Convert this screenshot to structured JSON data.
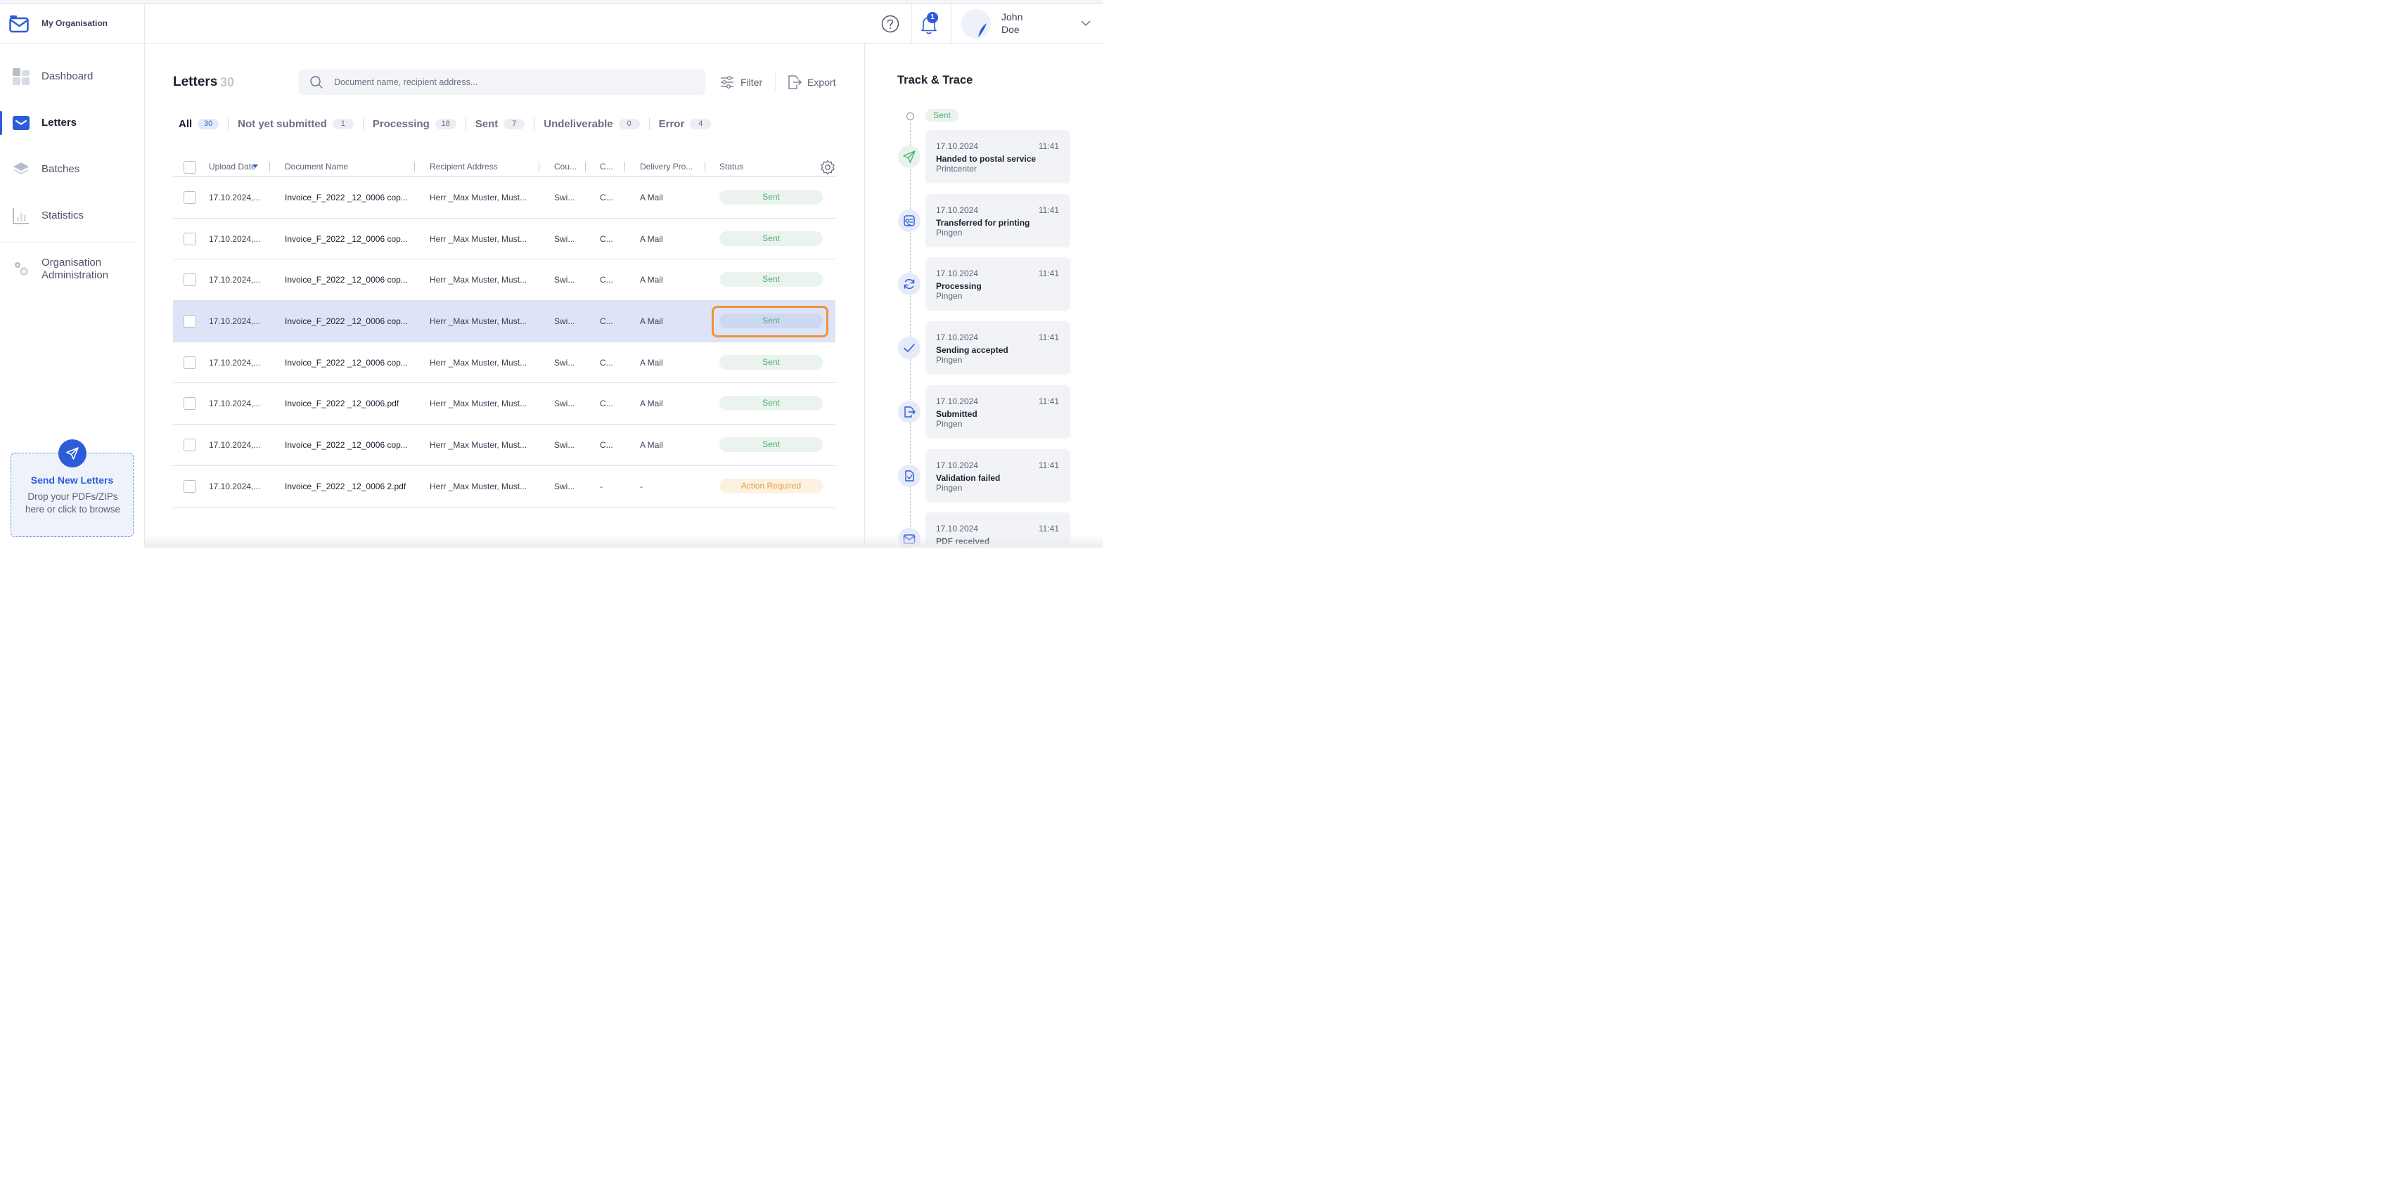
{
  "sidebar": {
    "org_name": "My Organisation",
    "nav": [
      {
        "label": "Dashboard",
        "icon": "dashboard-icon"
      },
      {
        "label": "Letters",
        "icon": "envelope-icon",
        "active": true
      },
      {
        "label": "Batches",
        "icon": "layers-icon"
      },
      {
        "label": "Statistics",
        "icon": "bar-chart-icon"
      },
      {
        "label": "Organisation Administration",
        "icon": "gear-icon"
      }
    ],
    "send": {
      "title": "Send New Letters",
      "description": "Drop your PDFs/ZIPs here or click to browse"
    }
  },
  "header": {
    "notification_count": "1",
    "user_first_name": "John",
    "user_last_name": "Doe"
  },
  "main": {
    "title": "Letters",
    "count": "30",
    "search_placeholder": "Document name, recipient address...",
    "filter_label": "Filter",
    "export_label": "Export",
    "tabs": [
      {
        "label": "All",
        "count": "30",
        "active": true
      },
      {
        "label": "Not yet submitted",
        "count": "1"
      },
      {
        "label": "Processing",
        "count": "18"
      },
      {
        "label": "Sent",
        "count": "7"
      },
      {
        "label": "Undeliverable",
        "count": "0"
      },
      {
        "label": "Error",
        "count": "4"
      }
    ],
    "columns": [
      "Upload Date",
      "Document Name",
      "Recipient Address",
      "Cou...",
      "C...",
      "Delivery Pro...",
      "Status"
    ],
    "rows": [
      {
        "date": "17.10.2024,...",
        "doc": "Invoice_F_2022 _12_0006 cop...",
        "recipient": "Herr _Max Muster, Must...",
        "country": "Swi...",
        "c": "C...",
        "delivery": "A Mail",
        "status": "Sent",
        "status_type": "sent"
      },
      {
        "date": "17.10.2024,...",
        "doc": "Invoice_F_2022 _12_0006 cop...",
        "recipient": "Herr _Max Muster, Must...",
        "country": "Swi...",
        "c": "C...",
        "delivery": "A Mail",
        "status": "Sent",
        "status_type": "sent"
      },
      {
        "date": "17.10.2024,...",
        "doc": "Invoice_F_2022 _12_0006 cop...",
        "recipient": "Herr _Max Muster, Must...",
        "country": "Swi...",
        "c": "C...",
        "delivery": "A Mail",
        "status": "Sent",
        "status_type": "sent"
      },
      {
        "date": "17.10.2024,...",
        "doc": "Invoice_F_2022 _12_0006 cop...",
        "recipient": "Herr _Max Muster, Must...",
        "country": "Swi...",
        "c": "C...",
        "delivery": "A Mail",
        "status": "Sent",
        "status_type": "sent",
        "selected": true
      },
      {
        "date": "17.10.2024,...",
        "doc": "Invoice_F_2022 _12_0006 cop...",
        "recipient": "Herr _Max Muster, Must...",
        "country": "Swi...",
        "c": "C...",
        "delivery": "A Mail",
        "status": "Sent",
        "status_type": "sent"
      },
      {
        "date": "17.10.2024,...",
        "doc": "Invoice_F_2022 _12_0006.pdf",
        "recipient": "Herr _Max Muster, Must...",
        "country": "Swi...",
        "c": "C...",
        "delivery": "A Mail",
        "status": "Sent",
        "status_type": "sent"
      },
      {
        "date": "17.10.2024,...",
        "doc": "Invoice_F_2022 _12_0006 cop...",
        "recipient": "Herr _Max Muster, Must...",
        "country": "Swi...",
        "c": "C...",
        "delivery": "A Mail",
        "status": "Sent",
        "status_type": "sent"
      },
      {
        "date": "17.10.2024,...",
        "doc": "Invoice_F_2022 _12_0006 2.pdf",
        "recipient": "Herr _Max Muster, Must...",
        "country": "Swi...",
        "c": "-",
        "delivery": "-",
        "status": "Action Required",
        "status_type": "warning"
      }
    ]
  },
  "trace": {
    "title": "Track & Trace",
    "current_status": "Sent",
    "events": [
      {
        "date": "17.10.2024",
        "time": "11:41",
        "title": "Handed to postal service",
        "source": "Printcenter",
        "icon": "paper-plane-icon"
      },
      {
        "date": "17.10.2024",
        "time": "11:41",
        "title": "Transferred for printing",
        "source": "Pingen",
        "icon": "printer-icon"
      },
      {
        "date": "17.10.2024",
        "time": "11:41",
        "title": "Processing",
        "source": "Pingen",
        "icon": "refresh-icon"
      },
      {
        "date": "17.10.2024",
        "time": "11:41",
        "title": "Sending accepted",
        "source": "Pingen",
        "icon": "checkmark-icon"
      },
      {
        "date": "17.10.2024",
        "time": "11:41",
        "title": "Submitted",
        "source": "Pingen",
        "icon": "submit-icon"
      },
      {
        "date": "17.10.2024",
        "time": "11:41",
        "title": "Validation failed",
        "source": "Pingen",
        "icon": "document-check-icon"
      },
      {
        "date": "17.10.2024",
        "time": "11:41",
        "title": "PDF received",
        "source": "",
        "icon": "envelope-icon"
      }
    ]
  },
  "colors": {
    "accent": "#2d5cdb",
    "sent_text": "#4fae74",
    "sent_bg": "#eaf3ee",
    "warning_text": "#e59d3a",
    "warning_bg": "#fdf1e1",
    "selected_row": "#dde4f8",
    "highlight_border": "#f0913a"
  }
}
